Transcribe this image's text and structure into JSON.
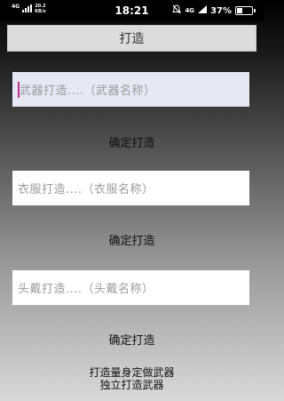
{
  "status_bar": {
    "network": "4G",
    "speed": "20.2",
    "speed_unit": "KB/s",
    "time": "18:21",
    "signal_label": "4G",
    "battery": "37%",
    "battery_level": 0.37
  },
  "title_button": "打造",
  "sections": [
    {
      "placeholder": "武器打造....（武器名称）",
      "action": "确定打造"
    },
    {
      "placeholder": "衣服打造....（衣服名称）",
      "action": "确定打造"
    },
    {
      "placeholder": "头戴打造....（头戴名称）",
      "action": "确定打造"
    }
  ],
  "footer": {
    "line1": "打造量身定做武器",
    "line2": "独立打造武器"
  }
}
